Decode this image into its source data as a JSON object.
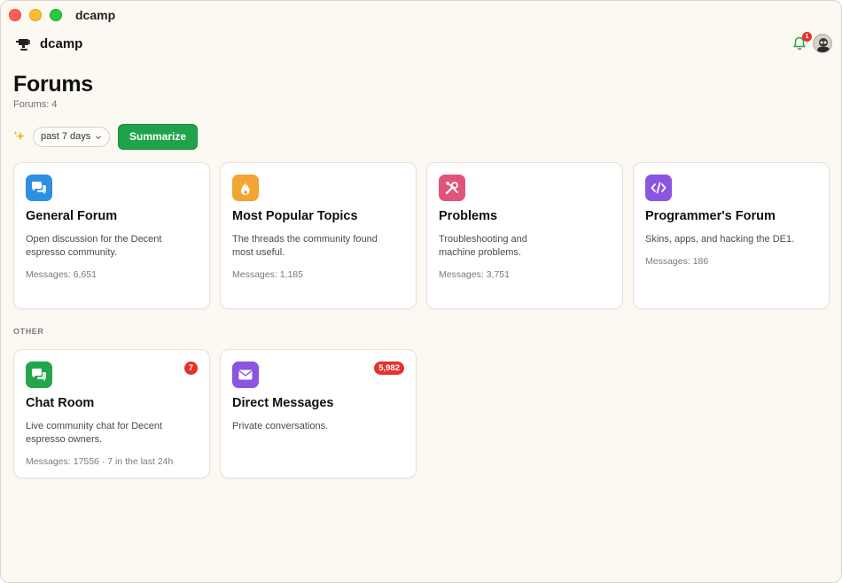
{
  "window": {
    "title": "dcamp"
  },
  "app": {
    "name": "dcamp",
    "notification_count": "1"
  },
  "page": {
    "title": "Forums",
    "count_text": "Forums: 4"
  },
  "toolbar": {
    "range_label": "past 7 days",
    "summarize_label": "Summarize"
  },
  "forums": [
    {
      "title": "General Forum",
      "description": "Open discussion for the Decent espresso community.",
      "meta": "Messages: 6,651",
      "icon": "chat-bubbles-icon",
      "color": "#2f8fe0"
    },
    {
      "title": "Most Popular Topics",
      "description": "The threads the community found most useful.",
      "meta": "Messages: 1,185",
      "icon": "flame-icon",
      "color": "#f2a531"
    },
    {
      "title": "Problems",
      "description": "Troubleshooting and machine problems.",
      "meta": "Messages: 3,751",
      "icon": "tools-icon",
      "color": "#e0547a"
    },
    {
      "title": "Programmer's Forum",
      "description": "Skins, apps, and hacking the DE1.",
      "meta": "Messages: 186",
      "icon": "code-icon",
      "color": "#8a55e0"
    }
  ],
  "other": {
    "label": "OTHER",
    "items": [
      {
        "title": "Chat Room",
        "description": "Live community chat for Decent espresso owners.",
        "meta": "Messages: 17556 · 7 in the last 24h",
        "badge": "7",
        "icon": "chat-bubbles-icon",
        "color": "#23a64b"
      },
      {
        "title": "Direct Messages",
        "description": "Private conversations.",
        "meta": "",
        "badge": "5,982",
        "icon": "envelope-icon",
        "color": "#8a55e0"
      }
    ]
  }
}
